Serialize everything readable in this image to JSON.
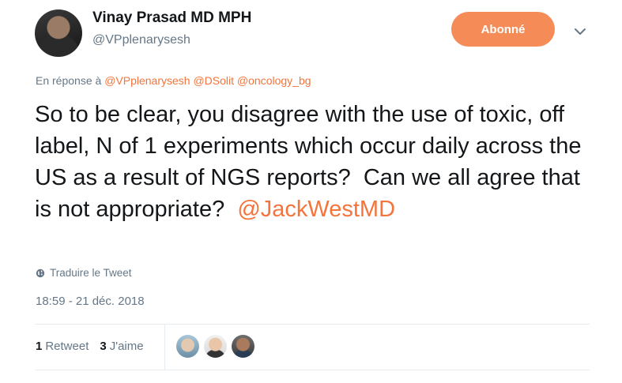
{
  "author": {
    "name": "Vinay Prasad MD MPH",
    "handle": "@VPplenarysesh"
  },
  "follow_button": {
    "label": "Abonné"
  },
  "reply_to": {
    "prefix": "En réponse à",
    "mentions": [
      "@VPplenarysesh",
      "@DSolit",
      "@oncology_bg"
    ]
  },
  "tweet": {
    "text": "So to be clear, you disagree with the use of toxic, off label, N of 1 experiments which occur daily across the US as a result of NGS reports?  Can we all agree that is not appropriate?  ",
    "mention": "@JackWestMD"
  },
  "translate": {
    "label": "Traduire le Tweet"
  },
  "timestamp": "18:59 - 21 déc. 2018",
  "stats": {
    "retweets_count": "1",
    "retweets_label": "Retweet",
    "likes_count": "3",
    "likes_label": "J'aime"
  },
  "colors": {
    "accent": "#f4743b",
    "button": "#f58b57",
    "secondary_text": "#657786",
    "divider": "#e6ecf0"
  },
  "icons": [
    "chevron-down-icon",
    "globe-icon"
  ]
}
